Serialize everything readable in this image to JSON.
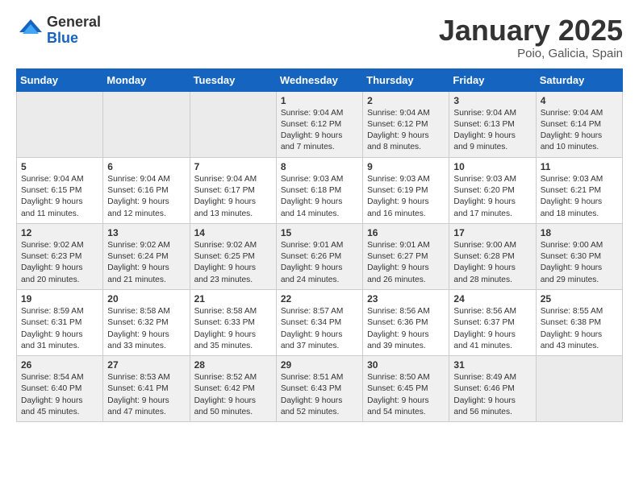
{
  "header": {
    "logo_general": "General",
    "logo_blue": "Blue",
    "month": "January 2025",
    "location": "Poio, Galicia, Spain"
  },
  "weekdays": [
    "Sunday",
    "Monday",
    "Tuesday",
    "Wednesday",
    "Thursday",
    "Friday",
    "Saturday"
  ],
  "weeks": [
    [
      {
        "day": "",
        "info": ""
      },
      {
        "day": "",
        "info": ""
      },
      {
        "day": "",
        "info": ""
      },
      {
        "day": "1",
        "info": "Sunrise: 9:04 AM\nSunset: 6:12 PM\nDaylight: 9 hours\nand 7 minutes."
      },
      {
        "day": "2",
        "info": "Sunrise: 9:04 AM\nSunset: 6:12 PM\nDaylight: 9 hours\nand 8 minutes."
      },
      {
        "day": "3",
        "info": "Sunrise: 9:04 AM\nSunset: 6:13 PM\nDaylight: 9 hours\nand 9 minutes."
      },
      {
        "day": "4",
        "info": "Sunrise: 9:04 AM\nSunset: 6:14 PM\nDaylight: 9 hours\nand 10 minutes."
      }
    ],
    [
      {
        "day": "5",
        "info": "Sunrise: 9:04 AM\nSunset: 6:15 PM\nDaylight: 9 hours\nand 11 minutes."
      },
      {
        "day": "6",
        "info": "Sunrise: 9:04 AM\nSunset: 6:16 PM\nDaylight: 9 hours\nand 12 minutes."
      },
      {
        "day": "7",
        "info": "Sunrise: 9:04 AM\nSunset: 6:17 PM\nDaylight: 9 hours\nand 13 minutes."
      },
      {
        "day": "8",
        "info": "Sunrise: 9:03 AM\nSunset: 6:18 PM\nDaylight: 9 hours\nand 14 minutes."
      },
      {
        "day": "9",
        "info": "Sunrise: 9:03 AM\nSunset: 6:19 PM\nDaylight: 9 hours\nand 16 minutes."
      },
      {
        "day": "10",
        "info": "Sunrise: 9:03 AM\nSunset: 6:20 PM\nDaylight: 9 hours\nand 17 minutes."
      },
      {
        "day": "11",
        "info": "Sunrise: 9:03 AM\nSunset: 6:21 PM\nDaylight: 9 hours\nand 18 minutes."
      }
    ],
    [
      {
        "day": "12",
        "info": "Sunrise: 9:02 AM\nSunset: 6:23 PM\nDaylight: 9 hours\nand 20 minutes."
      },
      {
        "day": "13",
        "info": "Sunrise: 9:02 AM\nSunset: 6:24 PM\nDaylight: 9 hours\nand 21 minutes."
      },
      {
        "day": "14",
        "info": "Sunrise: 9:02 AM\nSunset: 6:25 PM\nDaylight: 9 hours\nand 23 minutes."
      },
      {
        "day": "15",
        "info": "Sunrise: 9:01 AM\nSunset: 6:26 PM\nDaylight: 9 hours\nand 24 minutes."
      },
      {
        "day": "16",
        "info": "Sunrise: 9:01 AM\nSunset: 6:27 PM\nDaylight: 9 hours\nand 26 minutes."
      },
      {
        "day": "17",
        "info": "Sunrise: 9:00 AM\nSunset: 6:28 PM\nDaylight: 9 hours\nand 28 minutes."
      },
      {
        "day": "18",
        "info": "Sunrise: 9:00 AM\nSunset: 6:30 PM\nDaylight: 9 hours\nand 29 minutes."
      }
    ],
    [
      {
        "day": "19",
        "info": "Sunrise: 8:59 AM\nSunset: 6:31 PM\nDaylight: 9 hours\nand 31 minutes."
      },
      {
        "day": "20",
        "info": "Sunrise: 8:58 AM\nSunset: 6:32 PM\nDaylight: 9 hours\nand 33 minutes."
      },
      {
        "day": "21",
        "info": "Sunrise: 8:58 AM\nSunset: 6:33 PM\nDaylight: 9 hours\nand 35 minutes."
      },
      {
        "day": "22",
        "info": "Sunrise: 8:57 AM\nSunset: 6:34 PM\nDaylight: 9 hours\nand 37 minutes."
      },
      {
        "day": "23",
        "info": "Sunrise: 8:56 AM\nSunset: 6:36 PM\nDaylight: 9 hours\nand 39 minutes."
      },
      {
        "day": "24",
        "info": "Sunrise: 8:56 AM\nSunset: 6:37 PM\nDaylight: 9 hours\nand 41 minutes."
      },
      {
        "day": "25",
        "info": "Sunrise: 8:55 AM\nSunset: 6:38 PM\nDaylight: 9 hours\nand 43 minutes."
      }
    ],
    [
      {
        "day": "26",
        "info": "Sunrise: 8:54 AM\nSunset: 6:40 PM\nDaylight: 9 hours\nand 45 minutes."
      },
      {
        "day": "27",
        "info": "Sunrise: 8:53 AM\nSunset: 6:41 PM\nDaylight: 9 hours\nand 47 minutes."
      },
      {
        "day": "28",
        "info": "Sunrise: 8:52 AM\nSunset: 6:42 PM\nDaylight: 9 hours\nand 50 minutes."
      },
      {
        "day": "29",
        "info": "Sunrise: 8:51 AM\nSunset: 6:43 PM\nDaylight: 9 hours\nand 52 minutes."
      },
      {
        "day": "30",
        "info": "Sunrise: 8:50 AM\nSunset: 6:45 PM\nDaylight: 9 hours\nand 54 minutes."
      },
      {
        "day": "31",
        "info": "Sunrise: 8:49 AM\nSunset: 6:46 PM\nDaylight: 9 hours\nand 56 minutes."
      },
      {
        "day": "",
        "info": ""
      }
    ]
  ]
}
